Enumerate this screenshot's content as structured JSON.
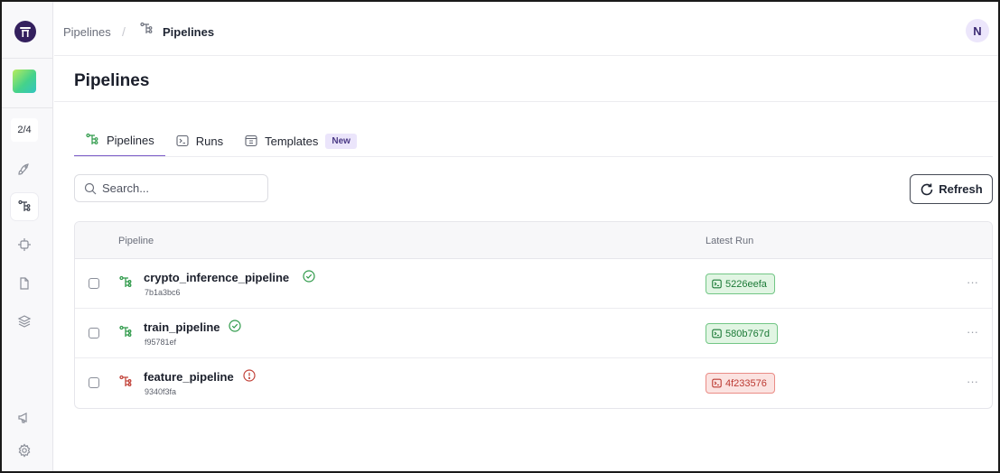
{
  "sidebar": {
    "step_counter": "2/4",
    "items": [
      {
        "icon": "rocket-icon"
      },
      {
        "icon": "pipeline-icon",
        "active": true
      },
      {
        "icon": "chip-icon"
      },
      {
        "icon": "file-icon"
      },
      {
        "icon": "stack-icon"
      }
    ],
    "bottom_items": [
      {
        "icon": "megaphone-icon"
      },
      {
        "icon": "settings-icon"
      }
    ]
  },
  "breadcrumb": {
    "root": "Pipelines",
    "current": "Pipelines"
  },
  "user": {
    "initial": "N"
  },
  "page": {
    "title": "Pipelines"
  },
  "tabs": [
    {
      "label": "Pipelines",
      "icon": "pipeline-icon",
      "active": true
    },
    {
      "label": "Runs",
      "icon": "terminal-icon"
    },
    {
      "label": "Templates",
      "icon": "template-icon",
      "badge": "New"
    }
  ],
  "search": {
    "placeholder": "Search..."
  },
  "refresh_label": "Refresh",
  "table": {
    "columns": [
      "Pipeline",
      "Latest Run"
    ],
    "rows": [
      {
        "name": "crypto_inference_pipeline",
        "id": "7b1a3bc6",
        "status": "success",
        "run": "5226eefa"
      },
      {
        "name": "train_pipeline",
        "id": "f95781ef",
        "status": "success",
        "run": "580b767d"
      },
      {
        "name": "feature_pipeline",
        "id": "9340f3fa",
        "status": "failed",
        "run": "4f233576"
      }
    ]
  },
  "colors": {
    "accent": "#7a5bc7",
    "success": "#1c7a37",
    "failed": "#bc3a32",
    "logo": "#34205e"
  }
}
